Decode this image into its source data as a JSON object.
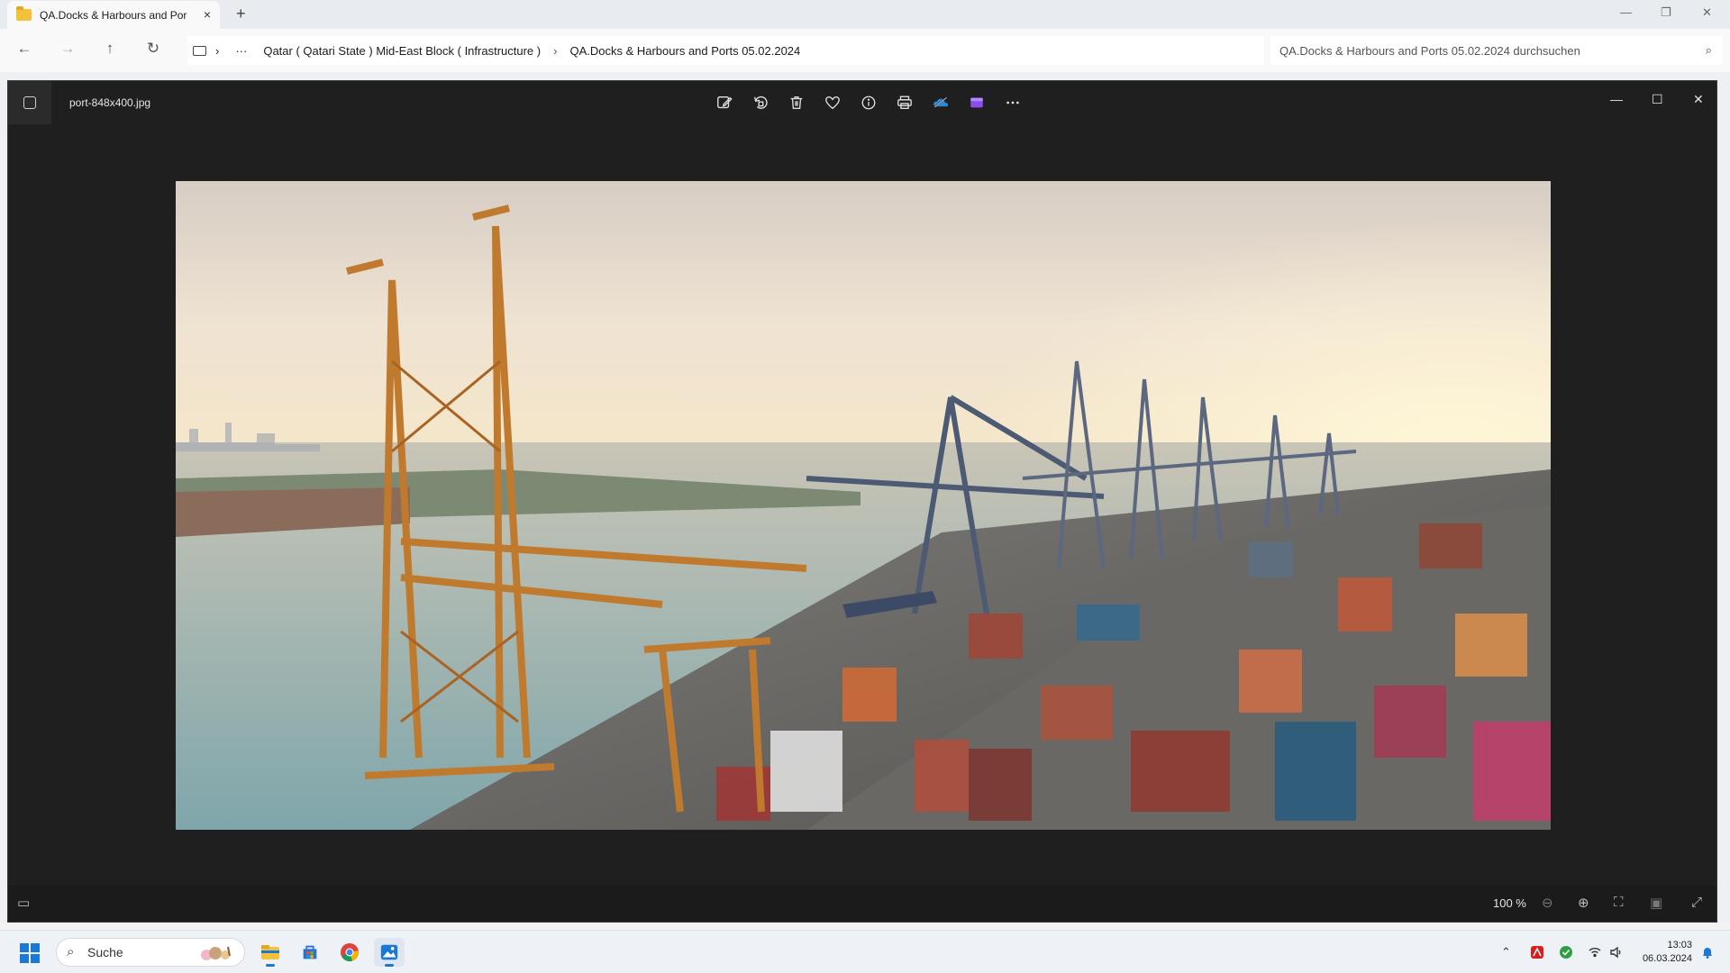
{
  "explorer": {
    "tab": {
      "title": "QA.Docks & Harbours and Por",
      "close_icon": "×"
    },
    "new_tab_icon": "+",
    "window_controls": {
      "minimize": "—",
      "maximize": "❐",
      "close": "✕"
    },
    "nav": {
      "back": "←",
      "forward": "→",
      "up": "↑",
      "refresh": "↻",
      "more": "···",
      "chevron": "›"
    },
    "breadcrumbs": [
      "Qatar ( Qatari State ) Mid-East Block ( Infrastructure )",
      "QA.Docks & Harbours and Ports 05.02.2024"
    ],
    "search": {
      "placeholder": "QA.Docks & Harbours and Ports 05.02.2024 durchsuchen",
      "icon": "⌕"
    }
  },
  "photos": {
    "file_name": "port-848x400.jpg",
    "toolbar": [
      {
        "name": "edit-image-icon",
        "glyph": "✎"
      },
      {
        "name": "rotate-icon",
        "glyph": "⟲"
      },
      {
        "name": "delete-icon",
        "glyph": "🗑"
      },
      {
        "name": "favorite-icon",
        "glyph": "♡"
      },
      {
        "name": "info-icon",
        "glyph": "ⓘ"
      },
      {
        "name": "print-icon",
        "glyph": "⎙"
      },
      {
        "name": "onedrive-icon",
        "glyph": "☁"
      },
      {
        "name": "clipchamp-icon",
        "glyph": "▰"
      },
      {
        "name": "more-options-icon",
        "glyph": "···"
      }
    ],
    "window_controls": {
      "minimize": "—",
      "maximize": "☐",
      "close": "✕"
    },
    "zoom_level": "100 %",
    "footer_icons": {
      "filmstrip": "▭",
      "zoom_out": "⊖",
      "zoom_in": "⊕",
      "fit": "⛶",
      "actual_size": "▣",
      "fullscreen": "⤢"
    },
    "colors": {
      "background": "#1f1f1f",
      "accent": "#1b78d4"
    }
  },
  "taskbar": {
    "search_label": "Suche",
    "time": "13:03",
    "date": "06.03.2024"
  }
}
